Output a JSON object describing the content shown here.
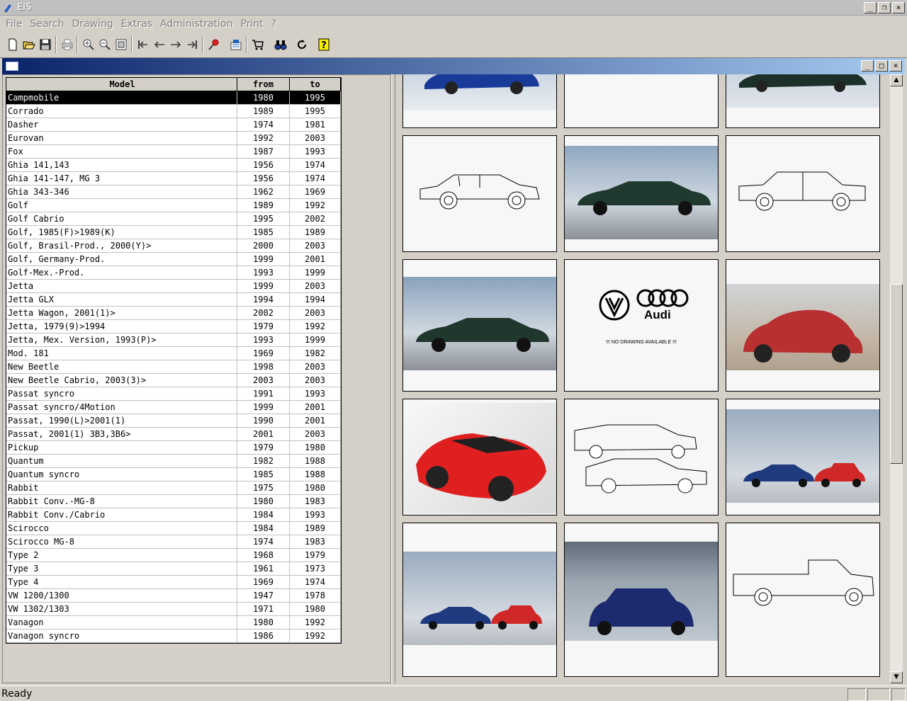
{
  "window": {
    "title": "EIS",
    "min": "_",
    "max": "□",
    "close": "×"
  },
  "menu": [
    "File",
    "Search",
    "Drawing",
    "Extras",
    "Administration",
    "Print",
    "?"
  ],
  "table": {
    "headers": {
      "model": "Model",
      "from": "from",
      "to": "to"
    },
    "rows": [
      [
        "Campmobile",
        "1980",
        "1995"
      ],
      [
        "Corrado",
        "1989",
        "1995"
      ],
      [
        "Dasher",
        "1974",
        "1981"
      ],
      [
        "Eurovan",
        "1992",
        "2003"
      ],
      [
        "Fox",
        "1987",
        "1993"
      ],
      [
        "Ghia 141,143",
        "1956",
        "1974"
      ],
      [
        "Ghia 141-147, MG 3",
        "1956",
        "1974"
      ],
      [
        "Ghia 343-346",
        "1962",
        "1969"
      ],
      [
        "Golf",
        "1989",
        "1992"
      ],
      [
        "Golf Cabrio",
        "1995",
        "2002"
      ],
      [
        "Golf, 1985(F)>1989(K)",
        "1985",
        "1989"
      ],
      [
        "Golf, Brasil-Prod., 2000(Y)>",
        "2000",
        "2003"
      ],
      [
        "Golf, Germany-Prod.",
        "1999",
        "2001"
      ],
      [
        "Golf-Mex.-Prod.",
        "1993",
        "1999"
      ],
      [
        "Jetta",
        "1999",
        "2003"
      ],
      [
        "Jetta GLX",
        "1994",
        "1994"
      ],
      [
        "Jetta Wagon, 2001(1)>",
        "2002",
        "2003"
      ],
      [
        "Jetta, 1979(9)>1994",
        "1979",
        "1992"
      ],
      [
        "Jetta, Mex. Version, 1993(P)>",
        "1993",
        "1999"
      ],
      [
        "Mod. 181",
        "1969",
        "1982"
      ],
      [
        "New Beetle",
        "1998",
        "2003"
      ],
      [
        "New Beetle Cabrio, 2003(3)>",
        "2003",
        "2003"
      ],
      [
        "Passat syncro",
        "1991",
        "1993"
      ],
      [
        "Passat syncro/4Motion",
        "1999",
        "2001"
      ],
      [
        "Passat, 1990(L)>2001(1)",
        "1990",
        "2001"
      ],
      [
        "Passat, 2001(1) 3B3,3B6>",
        "2001",
        "2003"
      ],
      [
        "Pickup",
        "1979",
        "1980"
      ],
      [
        "Quantum",
        "1982",
        "1988"
      ],
      [
        "Quantum syncro",
        "1985",
        "1988"
      ],
      [
        "Rabbit",
        "1975",
        "1980"
      ],
      [
        "Rabbit Conv.-MG-8",
        "1980",
        "1983"
      ],
      [
        "Rabbit Conv./Cabrio",
        "1984",
        "1993"
      ],
      [
        "Scirocco",
        "1984",
        "1989"
      ],
      [
        "Scirocco MG-8",
        "1974",
        "1983"
      ],
      [
        "Type 2",
        "1968",
        "1979"
      ],
      [
        "Type 3",
        "1961",
        "1973"
      ],
      [
        "Type 4",
        "1969",
        "1974"
      ],
      [
        "VW 1200/1300",
        "1947",
        "1978"
      ],
      [
        "VW 1302/1303",
        "1971",
        "1980"
      ],
      [
        "Vanagon",
        "1980",
        "1992"
      ],
      [
        "Vanagon syncro",
        "1986",
        "1992"
      ]
    ]
  },
  "gallery": {
    "vw_logo": "VW",
    "audi_text": "Audi",
    "no_drawing": "!!!    NO DRAWING AVAILABLE    !!!"
  },
  "status": {
    "text": "Ready"
  }
}
